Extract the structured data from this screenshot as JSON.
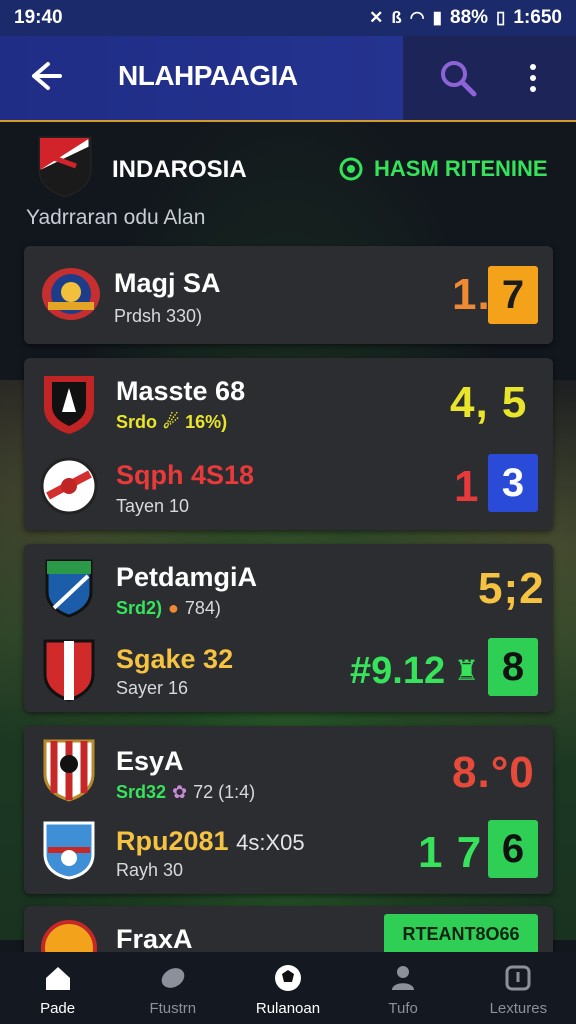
{
  "status": {
    "time": "19:40",
    "battery": "88%",
    "clock": "1:650"
  },
  "appbar": {
    "title": "NLAHPAAGIA"
  },
  "league": {
    "name": "INDAROSIA",
    "live_label": "HASM RITENINE",
    "subtitle": "Yadrraran odu Alan"
  },
  "matches": [
    {
      "team": "Magj SA",
      "meta": "Prdsh 330)",
      "score": "1.",
      "box": "7",
      "box_color": "#f5a21b"
    },
    {
      "team": "Masste 68",
      "meta_a": "Srdo",
      "meta_b": "16%)",
      "score": "4, 5",
      "team2": "Sqph 4S18",
      "meta2": "Tayen 10",
      "score2": "1",
      "box2": "3",
      "box2_color": "#2a4bd8"
    },
    {
      "team": "PetdamgiA",
      "meta_a": "Srd2)",
      "meta_b": "784)",
      "score": "5;2",
      "team2": "Sgake 32",
      "meta2": "Sayer 16",
      "odds": "#9.12",
      "box2": "8",
      "box2_color": "#2fcf55"
    },
    {
      "team": "EsyA",
      "meta_a": "Srd32",
      "meta_b": "72 (1:4)",
      "score": "8.°0",
      "team2": "Rpu2081",
      "team2_extra": "4s:X05",
      "meta2": "Rayh 30",
      "score2": "1 7",
      "box2": "6",
      "box2_color": "#2fcf55"
    },
    {
      "team": "FraxA",
      "button": "RTEANT8O66"
    }
  ],
  "nav": [
    {
      "label": "Pade",
      "icon": "home-icon"
    },
    {
      "label": "Ftustrn",
      "icon": "ball-icon"
    },
    {
      "label": "Rulanoan",
      "icon": "soccer-icon"
    },
    {
      "label": "Tufo",
      "icon": "person-icon"
    },
    {
      "label": "Lextures",
      "icon": "stats-icon"
    }
  ],
  "colors": {
    "accent": "#1f2d86",
    "live": "#36e35b",
    "card": "#2b2d31",
    "orange": "#f08a32",
    "yellow": "#e9e52a",
    "red": "#e83a3a"
  }
}
